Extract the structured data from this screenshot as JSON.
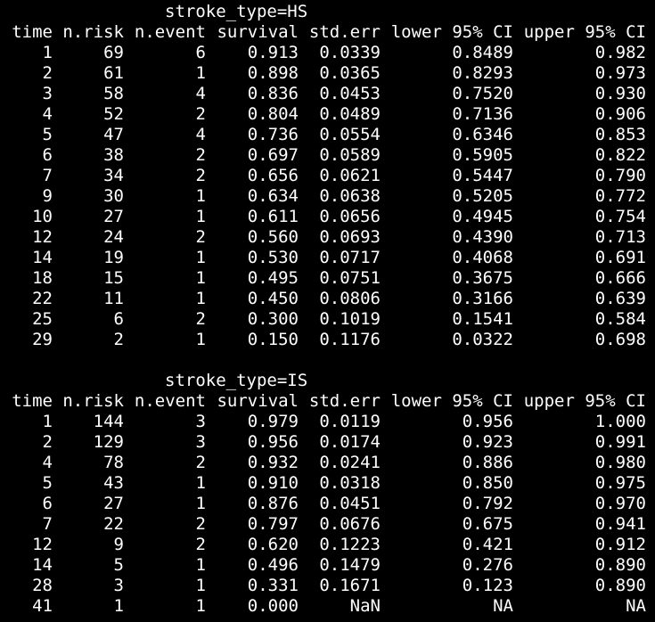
{
  "columns": [
    "time",
    "n.risk",
    "n.event",
    "survival",
    "std.err",
    "lower 95% CI",
    "upper 95% CI"
  ],
  "groups": [
    {
      "label": "stroke_type=HS",
      "rows": [
        [
          "1",
          "69",
          "6",
          "0.913",
          "0.0339",
          "0.8489",
          "0.982"
        ],
        [
          "2",
          "61",
          "1",
          "0.898",
          "0.0365",
          "0.8293",
          "0.973"
        ],
        [
          "3",
          "58",
          "4",
          "0.836",
          "0.0453",
          "0.7520",
          "0.930"
        ],
        [
          "4",
          "52",
          "2",
          "0.804",
          "0.0489",
          "0.7136",
          "0.906"
        ],
        [
          "5",
          "47",
          "4",
          "0.736",
          "0.0554",
          "0.6346",
          "0.853"
        ],
        [
          "6",
          "38",
          "2",
          "0.697",
          "0.0589",
          "0.5905",
          "0.822"
        ],
        [
          "7",
          "34",
          "2",
          "0.656",
          "0.0621",
          "0.5447",
          "0.790"
        ],
        [
          "9",
          "30",
          "1",
          "0.634",
          "0.0638",
          "0.5205",
          "0.772"
        ],
        [
          "10",
          "27",
          "1",
          "0.611",
          "0.0656",
          "0.4945",
          "0.754"
        ],
        [
          "12",
          "24",
          "2",
          "0.560",
          "0.0693",
          "0.4390",
          "0.713"
        ],
        [
          "14",
          "19",
          "1",
          "0.530",
          "0.0717",
          "0.4068",
          "0.691"
        ],
        [
          "18",
          "15",
          "1",
          "0.495",
          "0.0751",
          "0.3675",
          "0.666"
        ],
        [
          "22",
          "11",
          "1",
          "0.450",
          "0.0806",
          "0.3166",
          "0.639"
        ],
        [
          "25",
          "6",
          "2",
          "0.300",
          "0.1019",
          "0.1541",
          "0.584"
        ],
        [
          "29",
          "2",
          "1",
          "0.150",
          "0.1176",
          "0.0322",
          "0.698"
        ]
      ]
    },
    {
      "label": "stroke_type=IS",
      "rows": [
        [
          "1",
          "144",
          "3",
          "0.979",
          "0.0119",
          "0.956",
          "1.000"
        ],
        [
          "2",
          "129",
          "3",
          "0.956",
          "0.0174",
          "0.923",
          "0.991"
        ],
        [
          "4",
          "78",
          "2",
          "0.932",
          "0.0241",
          "0.886",
          "0.980"
        ],
        [
          "5",
          "43",
          "1",
          "0.910",
          "0.0318",
          "0.850",
          "0.975"
        ],
        [
          "6",
          "27",
          "1",
          "0.876",
          "0.0451",
          "0.792",
          "0.970"
        ],
        [
          "7",
          "22",
          "2",
          "0.797",
          "0.0676",
          "0.675",
          "0.941"
        ],
        [
          "12",
          "9",
          "2",
          "0.620",
          "0.1223",
          "0.421",
          "0.912"
        ],
        [
          "14",
          "5",
          "1",
          "0.496",
          "0.1479",
          "0.276",
          "0.890"
        ],
        [
          "28",
          "3",
          "1",
          "0.331",
          "0.1671",
          "0.123",
          "0.890"
        ],
        [
          "41",
          "1",
          "1",
          "0.000",
          "NaN",
          "NA",
          "NA"
        ]
      ]
    }
  ]
}
